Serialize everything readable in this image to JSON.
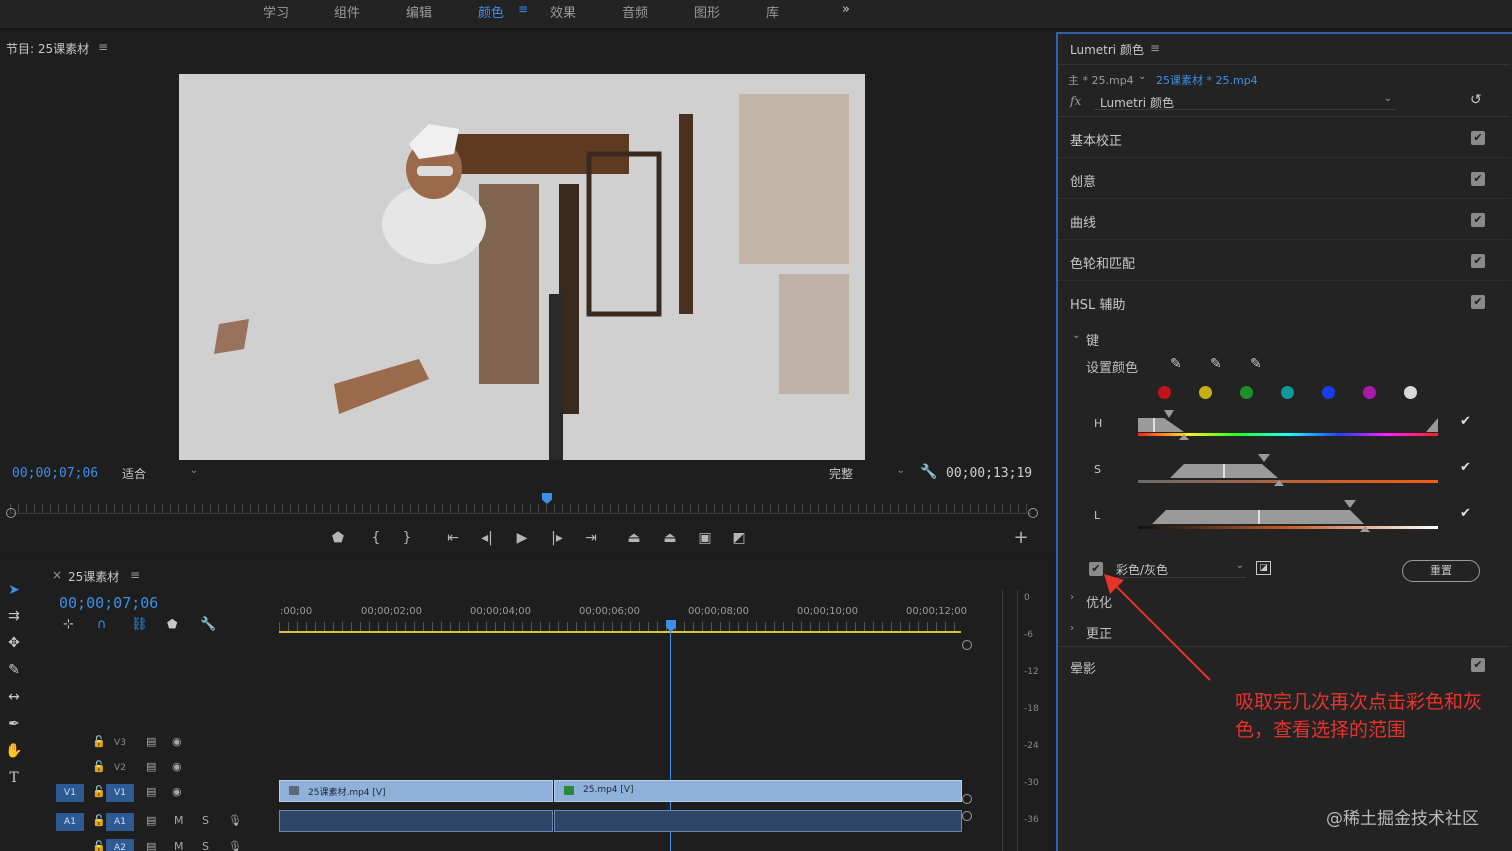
{
  "workspaces": {
    "tabs": [
      "学习",
      "组件",
      "编辑",
      "颜色",
      "效果",
      "音频",
      "图形",
      "库"
    ],
    "active": "颜色",
    "overflow": "»"
  },
  "program_monitor": {
    "title": "节目: 25课素材",
    "timecode_current": "00;00;07;06",
    "zoom_select": "适合",
    "quality_select": "完整",
    "timecode_duration": "00;00;13;19"
  },
  "timeline": {
    "tab_title": "25课素材",
    "close_glyph": "×",
    "timecode": "00;00;07;06",
    "ruler_labels": [
      ":00;00",
      "00;00;02;00",
      "00;00;04;00",
      "00;00;06;00",
      "00;00;08;00",
      "00;00;10;00",
      "00;00;12;00"
    ],
    "playhead_position_seconds": 7.2,
    "tracks": [
      {
        "id": "V3",
        "source": ""
      },
      {
        "id": "V2",
        "source": ""
      },
      {
        "id": "V1",
        "source": "V1"
      },
      {
        "id": "A1",
        "source": "A1",
        "m": "M",
        "s": "S"
      },
      {
        "id": "A2",
        "source": "",
        "m": "M",
        "s": "S"
      }
    ],
    "clips": [
      {
        "label": "25课素材.mp4 [V]"
      },
      {
        "label": "25.mp4 [V]"
      }
    ]
  },
  "meter": {
    "labels": [
      "0",
      "-6",
      "-12",
      "-18",
      "-24",
      "-30",
      "-36"
    ]
  },
  "lumetri": {
    "title": "Lumetri 颜色",
    "master_label": "主 * 25.mp4",
    "clip_label": "25课素材 * 25.mp4",
    "fx_label": "fx",
    "effect_name": "Lumetri 颜色",
    "sections": [
      {
        "label": "基本校正",
        "checked": true
      },
      {
        "label": "创意",
        "checked": true
      },
      {
        "label": "曲线",
        "checked": true
      },
      {
        "label": "色轮和匹配",
        "checked": true
      },
      {
        "label": "HSL 辅助",
        "checked": true
      }
    ],
    "key_section": "键",
    "set_color_label": "设置颜色",
    "swatches": [
      "#c0141a",
      "#c4b016",
      "#1a8f2a",
      "#0f9a9a",
      "#1a3ce8",
      "#a81aa8",
      "#d8d8d8"
    ],
    "hsl_rows": [
      "H",
      "S",
      "L"
    ],
    "color_gray_checked": true,
    "color_gray_select": "彩色/灰色",
    "reset_button": "重置",
    "subsections": [
      "优化",
      "更正"
    ],
    "vignette": {
      "label": "晕影",
      "checked": true
    }
  },
  "annotation": {
    "line1": "吸取完几次再次点击彩色和灰",
    "line2": "色，查看选择的范围",
    "color": "#e8332a"
  },
  "watermark": "@稀土掘金技术社区"
}
